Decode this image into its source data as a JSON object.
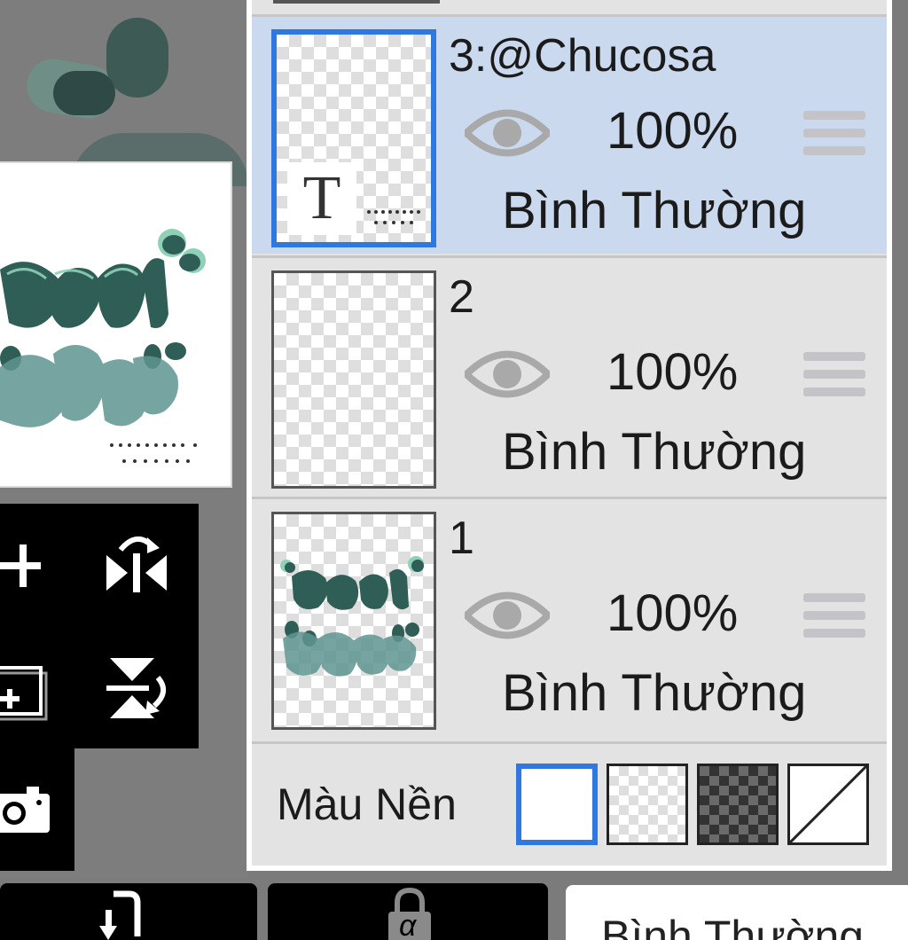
{
  "layers_panel": {
    "layers": [
      {
        "name": "3:@Chucosa",
        "opacity": "100%",
        "blend_mode": "Bình Thường",
        "visible": true,
        "selected": true,
        "has_text_badge": true,
        "text_badge": "T"
      },
      {
        "name": "2",
        "opacity": "100%",
        "blend_mode": "Bình Thường",
        "visible": true,
        "selected": false,
        "has_text_badge": false
      },
      {
        "name": "1",
        "opacity": "100%",
        "blend_mode": "Bình Thường",
        "visible": true,
        "selected": false,
        "has_text_badge": false
      }
    ],
    "background": {
      "label": "Màu Nền",
      "options": [
        "white",
        "light-checker",
        "dark-checker",
        "none"
      ],
      "selected": "white"
    }
  },
  "toolbar": {
    "tools": [
      "add-layer",
      "flip-horizontal",
      "add-copy-layer",
      "flip-vertical",
      "camera"
    ]
  },
  "bottom_bar": {
    "blend_mode_label": "Bình Thường",
    "alpha_lock_label": "α"
  },
  "colors": {
    "accent": "#2f78e0",
    "selected_row": "#cbd9ee",
    "panel_bg": "#e3e3e3",
    "artwork_teal": "#2f5e57",
    "artwork_mint": "#8fd1b6"
  }
}
